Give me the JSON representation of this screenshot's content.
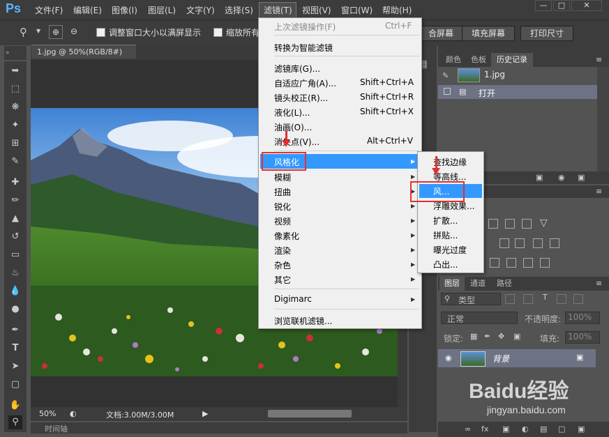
{
  "app": {
    "logo": "Ps"
  },
  "menubar": {
    "items": [
      "文件(F)",
      "编辑(E)",
      "图像(I)",
      "图层(L)",
      "文字(Y)",
      "选择(S)",
      "滤镜(T)",
      "视图(V)",
      "窗口(W)",
      "帮助(H)"
    ],
    "active": "滤镜(T)"
  },
  "options": {
    "resize_window_label": "调整窗口大小以满屏显示",
    "zoom_all_label": "缩放所有",
    "fit_screen": "合屏幕",
    "fill_screen": "填充屏幕",
    "print_size": "打印尺寸"
  },
  "document": {
    "tab_title": "1.jpg @ 50%(RGB/8#)",
    "zoom": "50%",
    "doc_info": "文档:3.00M/3.00M",
    "timeline": "时间轴"
  },
  "filter_menu": {
    "items": [
      {
        "label": "上次滤镜操作(F)",
        "shortcut": "Ctrl+F",
        "disabled": true
      },
      {
        "label": "转换为智能滤镜"
      },
      {
        "label": "滤镜库(G)..."
      },
      {
        "label": "自适应广角(A)...",
        "shortcut": "Shift+Ctrl+A"
      },
      {
        "label": "镜头校正(R)...",
        "shortcut": "Shift+Ctrl+R"
      },
      {
        "label": "液化(L)...",
        "shortcut": "Shift+Ctrl+X"
      },
      {
        "label": "油画(O)..."
      },
      {
        "label": "消失点(V)...",
        "shortcut": "Alt+Ctrl+V"
      },
      {
        "label": "风格化",
        "submenu": true,
        "highlighted": true
      },
      {
        "label": "模糊",
        "submenu": true
      },
      {
        "label": "扭曲",
        "submenu": true
      },
      {
        "label": "锐化",
        "submenu": true
      },
      {
        "label": "视频",
        "submenu": true
      },
      {
        "label": "像素化",
        "submenu": true
      },
      {
        "label": "渲染",
        "submenu": true
      },
      {
        "label": "杂色",
        "submenu": true
      },
      {
        "label": "其它",
        "submenu": true
      },
      {
        "label": "Digimarc",
        "submenu": true
      },
      {
        "label": "浏览联机滤镜..."
      }
    ]
  },
  "stylize_submenu": {
    "items": [
      {
        "label": "查找边缘"
      },
      {
        "label": "等高线..."
      },
      {
        "label": "风...",
        "highlighted": true
      },
      {
        "label": "浮雕效果..."
      },
      {
        "label": "扩散..."
      },
      {
        "label": "拼贴..."
      },
      {
        "label": "曝光过度"
      },
      {
        "label": "凸出..."
      }
    ]
  },
  "history_panel": {
    "tabs": [
      "颜色",
      "色板",
      "历史记录"
    ],
    "active_tab": "历史记录",
    "snapshot": "1.jpg",
    "entries": [
      "打开"
    ]
  },
  "layers_panel": {
    "tabs": [
      "图层",
      "通道",
      "路径"
    ],
    "active_tab": "图层",
    "filter_kind": "类型",
    "blend_mode": "正常",
    "opacity_label": "不透明度:",
    "opacity_value": "100%",
    "lock_label": "锁定:",
    "fill_label": "填充:",
    "fill_value": "100%",
    "layers": [
      {
        "name": "背景",
        "locked": true
      }
    ]
  },
  "watermark": {
    "brand": "Baidu经验",
    "url": "jingyan.baidu.com"
  },
  "colors": {
    "menubar": "#3c3c3c",
    "panel": "#535353",
    "menu_highlight": "#3399ff",
    "annotation": "#e52f2f"
  }
}
